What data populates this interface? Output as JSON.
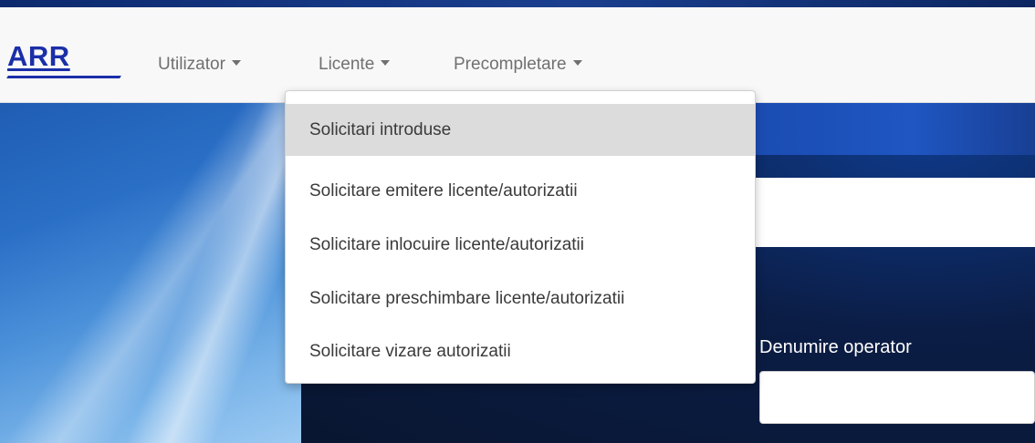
{
  "brand": {
    "logo_text": "ARR"
  },
  "navbar": {
    "items": [
      {
        "label": "Utilizator"
      },
      {
        "label": "Licente"
      },
      {
        "label": "Precompletare"
      }
    ]
  },
  "dropdown": {
    "items": [
      {
        "label": "Solicitari introduse",
        "highlighted": true
      },
      {
        "label": "Solicitare emitere licente/autorizatii"
      },
      {
        "label": "Solicitare inlocuire licente/autorizatii"
      },
      {
        "label": "Solicitare preschimbare licente/autorizatii"
      },
      {
        "label": "Solicitare vizare autorizatii"
      }
    ]
  },
  "form": {
    "operator_label": "Denumire operator",
    "operator_value": ""
  },
  "colors": {
    "brand_blue": "#1a2fa8",
    "navbar_bg": "#f8f8f8",
    "nav_text": "#707070",
    "dropdown_highlight": "#dcdcdc",
    "background_dark": "#0b1d45"
  }
}
